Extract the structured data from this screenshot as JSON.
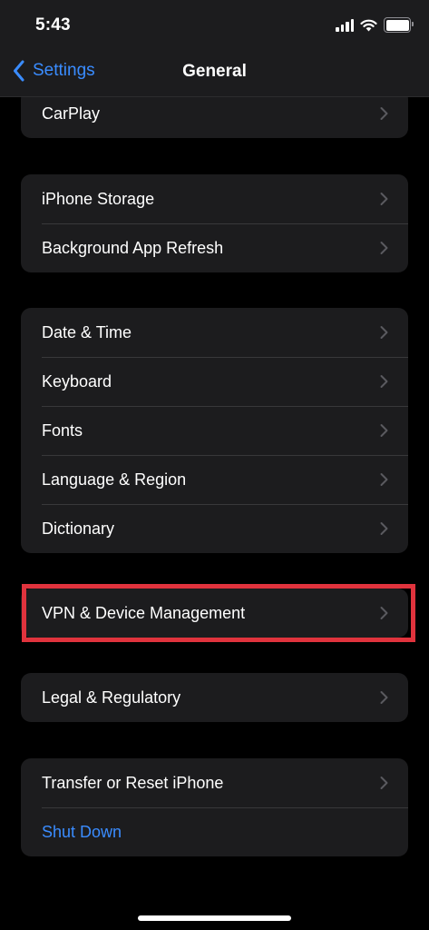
{
  "status_bar": {
    "time": "5:43"
  },
  "nav": {
    "back_label": "Settings",
    "title": "General"
  },
  "groups": [
    {
      "rows": [
        {
          "label": "CarPlay"
        }
      ]
    },
    {
      "rows": [
        {
          "label": "iPhone Storage"
        },
        {
          "label": "Background App Refresh"
        }
      ]
    },
    {
      "rows": [
        {
          "label": "Date & Time"
        },
        {
          "label": "Keyboard"
        },
        {
          "label": "Fonts"
        },
        {
          "label": "Language & Region"
        },
        {
          "label": "Dictionary"
        }
      ]
    },
    {
      "rows": [
        {
          "label": "VPN & Device Management"
        }
      ]
    },
    {
      "rows": [
        {
          "label": "Legal & Regulatory"
        }
      ]
    },
    {
      "rows": [
        {
          "label": "Transfer or Reset iPhone"
        },
        {
          "label": "Shut Down"
        }
      ]
    }
  ],
  "colors": {
    "accent": "#3a8cff",
    "highlight": "#e0333d",
    "cell_background": "#1c1c1e",
    "page_background": "#000000"
  },
  "icons": {
    "back": "chevron-left-icon",
    "disclosure": "chevron-right-icon",
    "signal": "cellular-signal-icon",
    "wifi": "wifi-icon",
    "battery": "battery-icon"
  }
}
